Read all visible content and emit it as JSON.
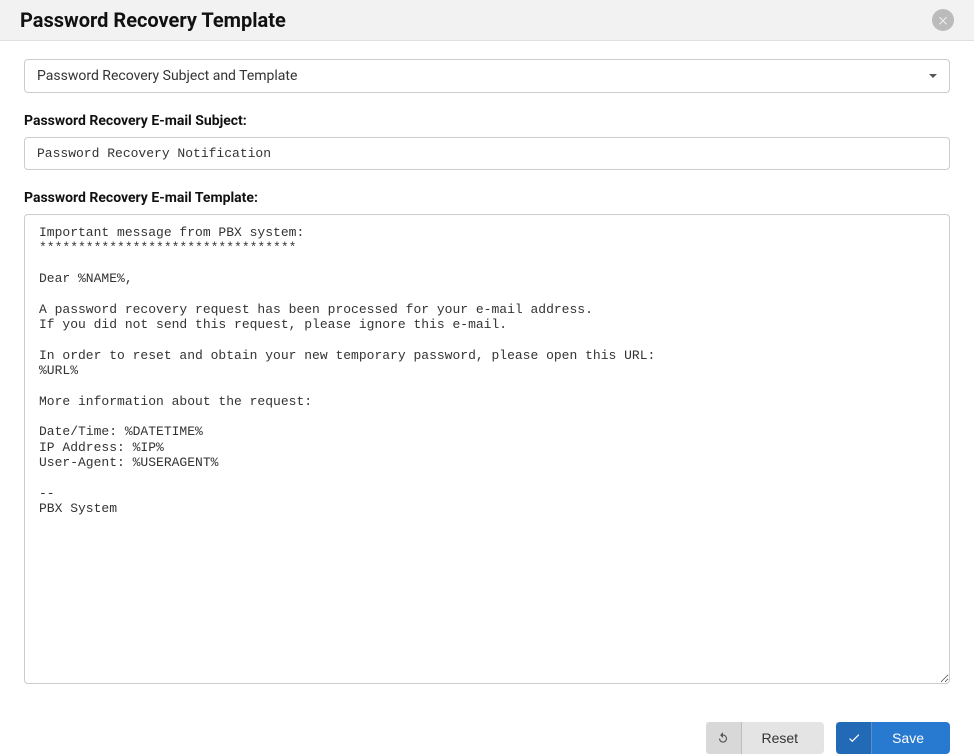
{
  "header": {
    "title": "Password Recovery Template"
  },
  "dropdown": {
    "selected": "Password Recovery Subject and Template"
  },
  "subject": {
    "label": "Password Recovery E-mail Subject:",
    "value": "Password Recovery Notification"
  },
  "template": {
    "label": "Password Recovery E-mail Template:",
    "value": "Important message from PBX system:\n*********************************\n\nDear %NAME%,\n\nA password recovery request has been processed for your e-mail address.\nIf you did not send this request, please ignore this e-mail.\n\nIn order to reset and obtain your new temporary password, please open this URL:\n%URL%\n\nMore information about the request:\n\nDate/Time: %DATETIME%\nIP Address: %IP%\nUser-Agent: %USERAGENT%\n\n--\nPBX System"
  },
  "footer": {
    "reset": "Reset",
    "save": "Save"
  }
}
